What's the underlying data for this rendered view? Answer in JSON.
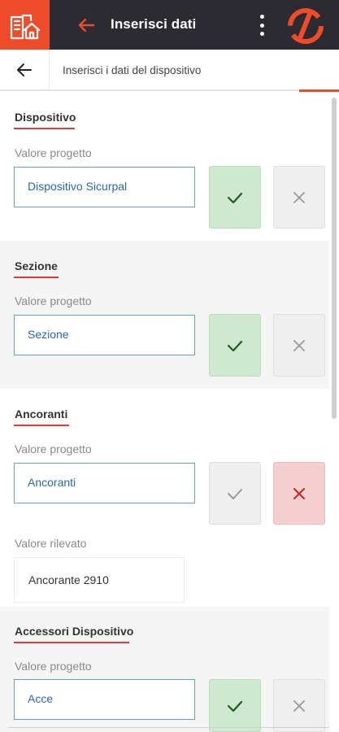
{
  "colors": {
    "accent": "#ee4b2b",
    "appbar": "#2b2b31",
    "input_border": "#5fa2e8",
    "input_text": "#2a67b0",
    "confirm_active": "#cfe8d0",
    "reject_active": "#f5cfcf",
    "check_green": "#1b5e20",
    "cross_red": "#c62828"
  },
  "appbar": {
    "title": "Inserisci dati",
    "home_icon": "building-home-icon",
    "back_icon": "arrow-left-icon",
    "menu_icon": "more-vertical-icon",
    "brand_icon": "brand-logo-icon"
  },
  "subheader": {
    "title": "Inserisci i dati del dispositivo",
    "back_icon": "arrow-left-icon"
  },
  "sections": [
    {
      "title": "Dispositivo",
      "project_label": "Valore progetto",
      "project_value": "Dispositivo Sicurpal",
      "confirm_state": "active",
      "reject_state": "inactive"
    },
    {
      "title": "Sezione",
      "project_label": "Valore progetto",
      "project_value": "Sezione",
      "confirm_state": "active",
      "reject_state": "inactive"
    },
    {
      "title": "Ancoranti",
      "project_label": "Valore progetto",
      "project_value": "Ancoranti",
      "confirm_state": "inactive",
      "reject_state": "active",
      "measured_label": "Valore rilevato",
      "measured_value": "Ancorante 2910"
    },
    {
      "title": "Accessori Dispositivo",
      "project_label": "Valore progetto",
      "project_value": "Acce",
      "confirm_state": "active",
      "reject_state": "inactive"
    }
  ]
}
